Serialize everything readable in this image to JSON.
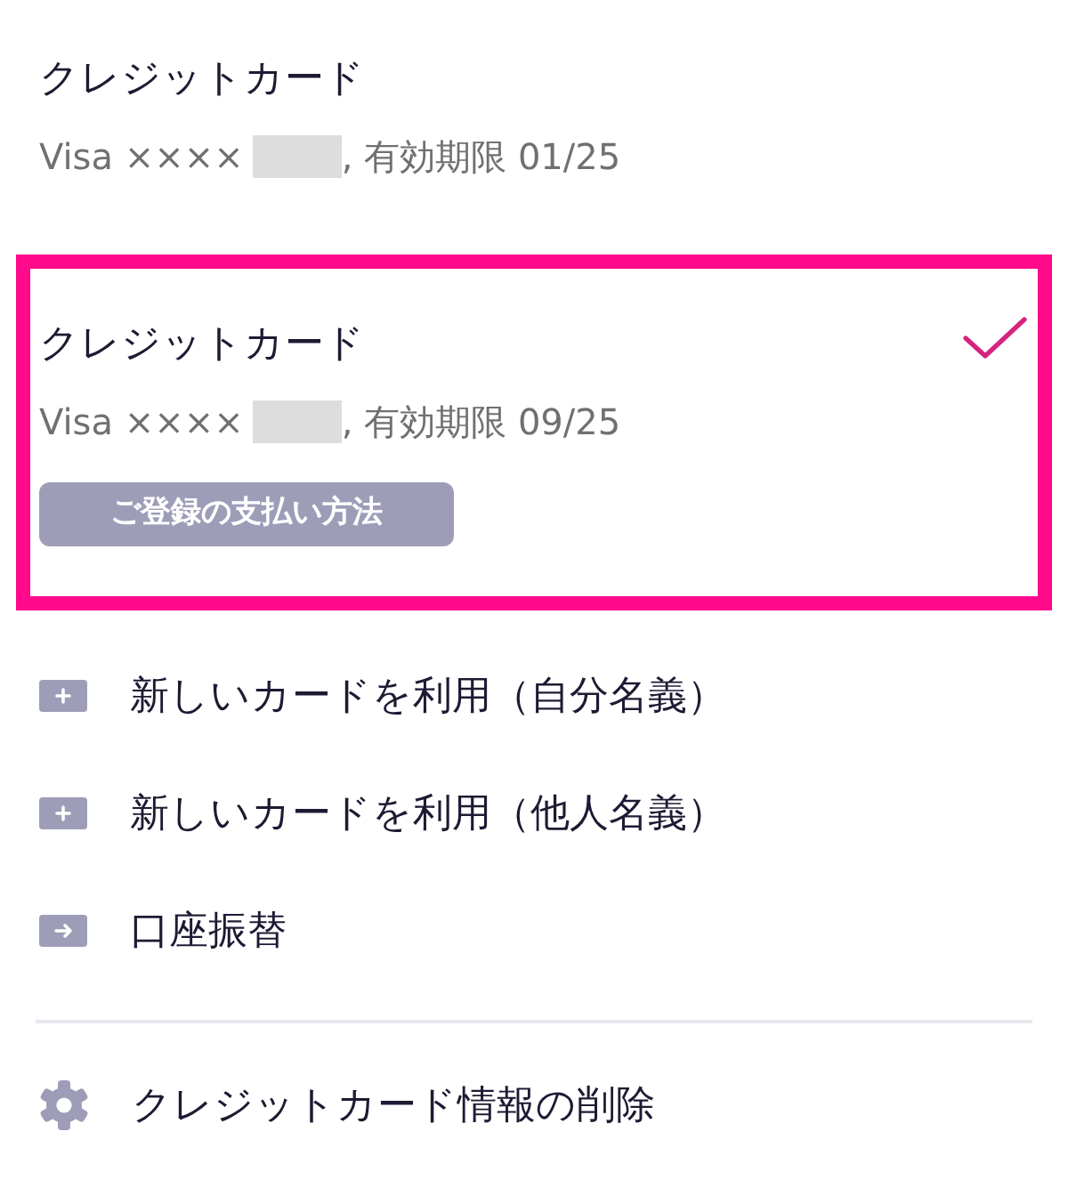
{
  "payment_methods": [
    {
      "title": "クレジットカード",
      "brand": "Visa ××××",
      "expiry": ", 有効期限 01/25",
      "selected": false
    },
    {
      "title": "クレジットカード",
      "brand": "Visa ××××",
      "expiry": ", 有効期限 09/25",
      "selected": true,
      "badge": "ご登録の支払い方法"
    }
  ],
  "options": [
    {
      "kind": "add",
      "label": "新しいカードを利用（自分名義）"
    },
    {
      "kind": "add",
      "label": "新しいカードを利用（他人名義）"
    },
    {
      "kind": "transfer",
      "label": "口座振替"
    }
  ],
  "settings": [
    {
      "kind": "gear",
      "label": "クレジットカード情報の削除"
    }
  ]
}
